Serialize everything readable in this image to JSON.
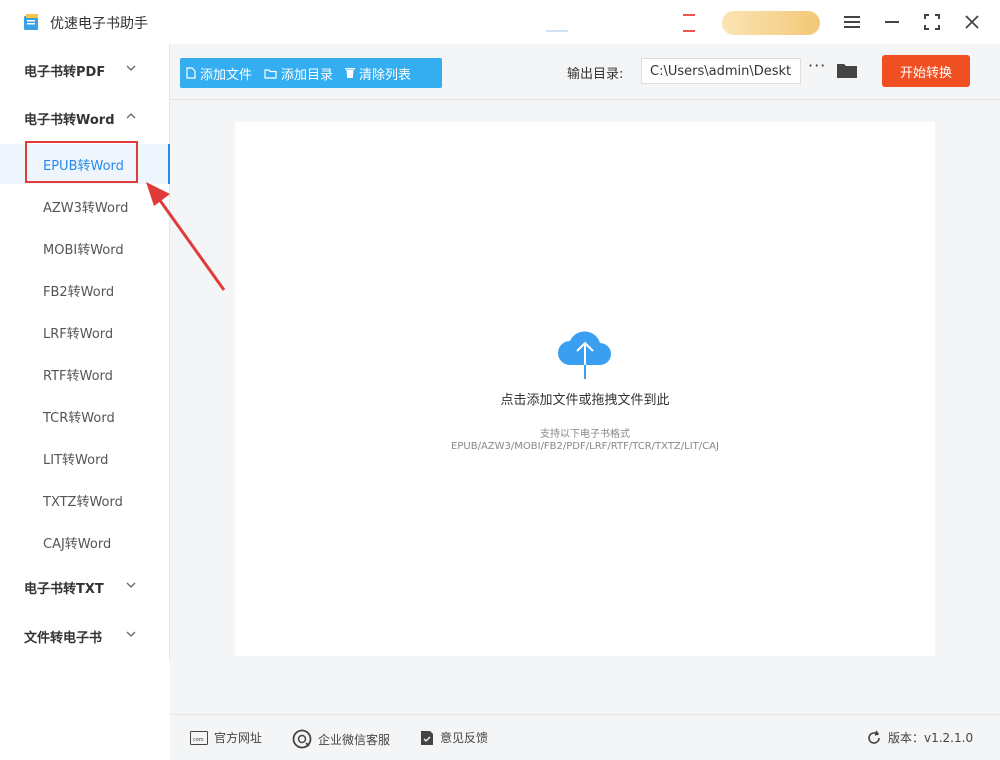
{
  "app": {
    "title": "优速电子书助手"
  },
  "sidebar": {
    "groups": [
      {
        "label": "电子书转PDF"
      },
      {
        "label": "电子书转Word"
      },
      {
        "label": "电子书转TXT"
      },
      {
        "label": "文件转电子书"
      }
    ],
    "word_items": [
      {
        "label": "EPUB转Word"
      },
      {
        "label": "AZW3转Word"
      },
      {
        "label": "MOBI转Word"
      },
      {
        "label": "FB2转Word"
      },
      {
        "label": "LRF转Word"
      },
      {
        "label": "RTF转Word"
      },
      {
        "label": "TCR转Word"
      },
      {
        "label": "LIT转Word"
      },
      {
        "label": "TXTZ转Word"
      },
      {
        "label": "CAJ转Word"
      }
    ]
  },
  "toolbar": {
    "add_file": "添加文件",
    "add_folder": "添加目录",
    "clear_list": "清除列表",
    "output_label": "输出目录:",
    "output_path": "C:\\Users\\admin\\Deskto",
    "more": "···",
    "start": "开始转换"
  },
  "dropzone": {
    "main_text": "点击添加文件或拖拽文件到此",
    "sub_text": "支持以下电子书格式",
    "formats": "EPUB/AZW3/MOBI/FB2/PDF/LRF/RTF/TCR/TXTZ/LIT/CAJ"
  },
  "footer": {
    "website": "官方网址",
    "wechat": "企业微信客服",
    "feedback": "意见反馈",
    "version": "版本：v1.2.1.0"
  },
  "colors": {
    "accent_blue": "#34aef0",
    "active_blue": "#2a8ae8",
    "start_red": "#f04f22",
    "annotation_red": "#e03a3a"
  }
}
